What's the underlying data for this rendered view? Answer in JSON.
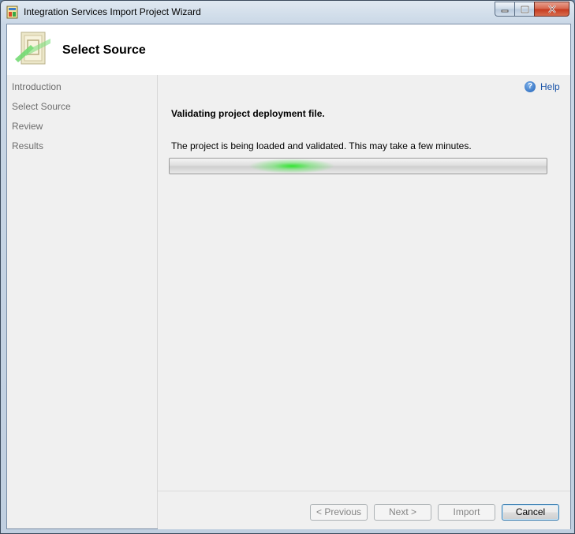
{
  "window": {
    "title": "Integration Services Import Project Wizard"
  },
  "header": {
    "page_title": "Select Source"
  },
  "sidebar": {
    "steps": [
      {
        "label": "Introduction"
      },
      {
        "label": "Select Source"
      },
      {
        "label": "Review"
      },
      {
        "label": "Results"
      }
    ]
  },
  "content": {
    "help_label": "Help",
    "heading": "Validating project deployment file.",
    "message": "The project is being loaded and validated. This may take a few minutes."
  },
  "buttons": {
    "previous": "< Previous",
    "next": "Next >",
    "import": "Import",
    "cancel": "Cancel"
  },
  "icons": {
    "app": "wizard-app-icon",
    "header": "project-import-icon",
    "help": "help-icon"
  },
  "colors": {
    "progress_glow": "#22e022",
    "link": "#1a53a8"
  }
}
